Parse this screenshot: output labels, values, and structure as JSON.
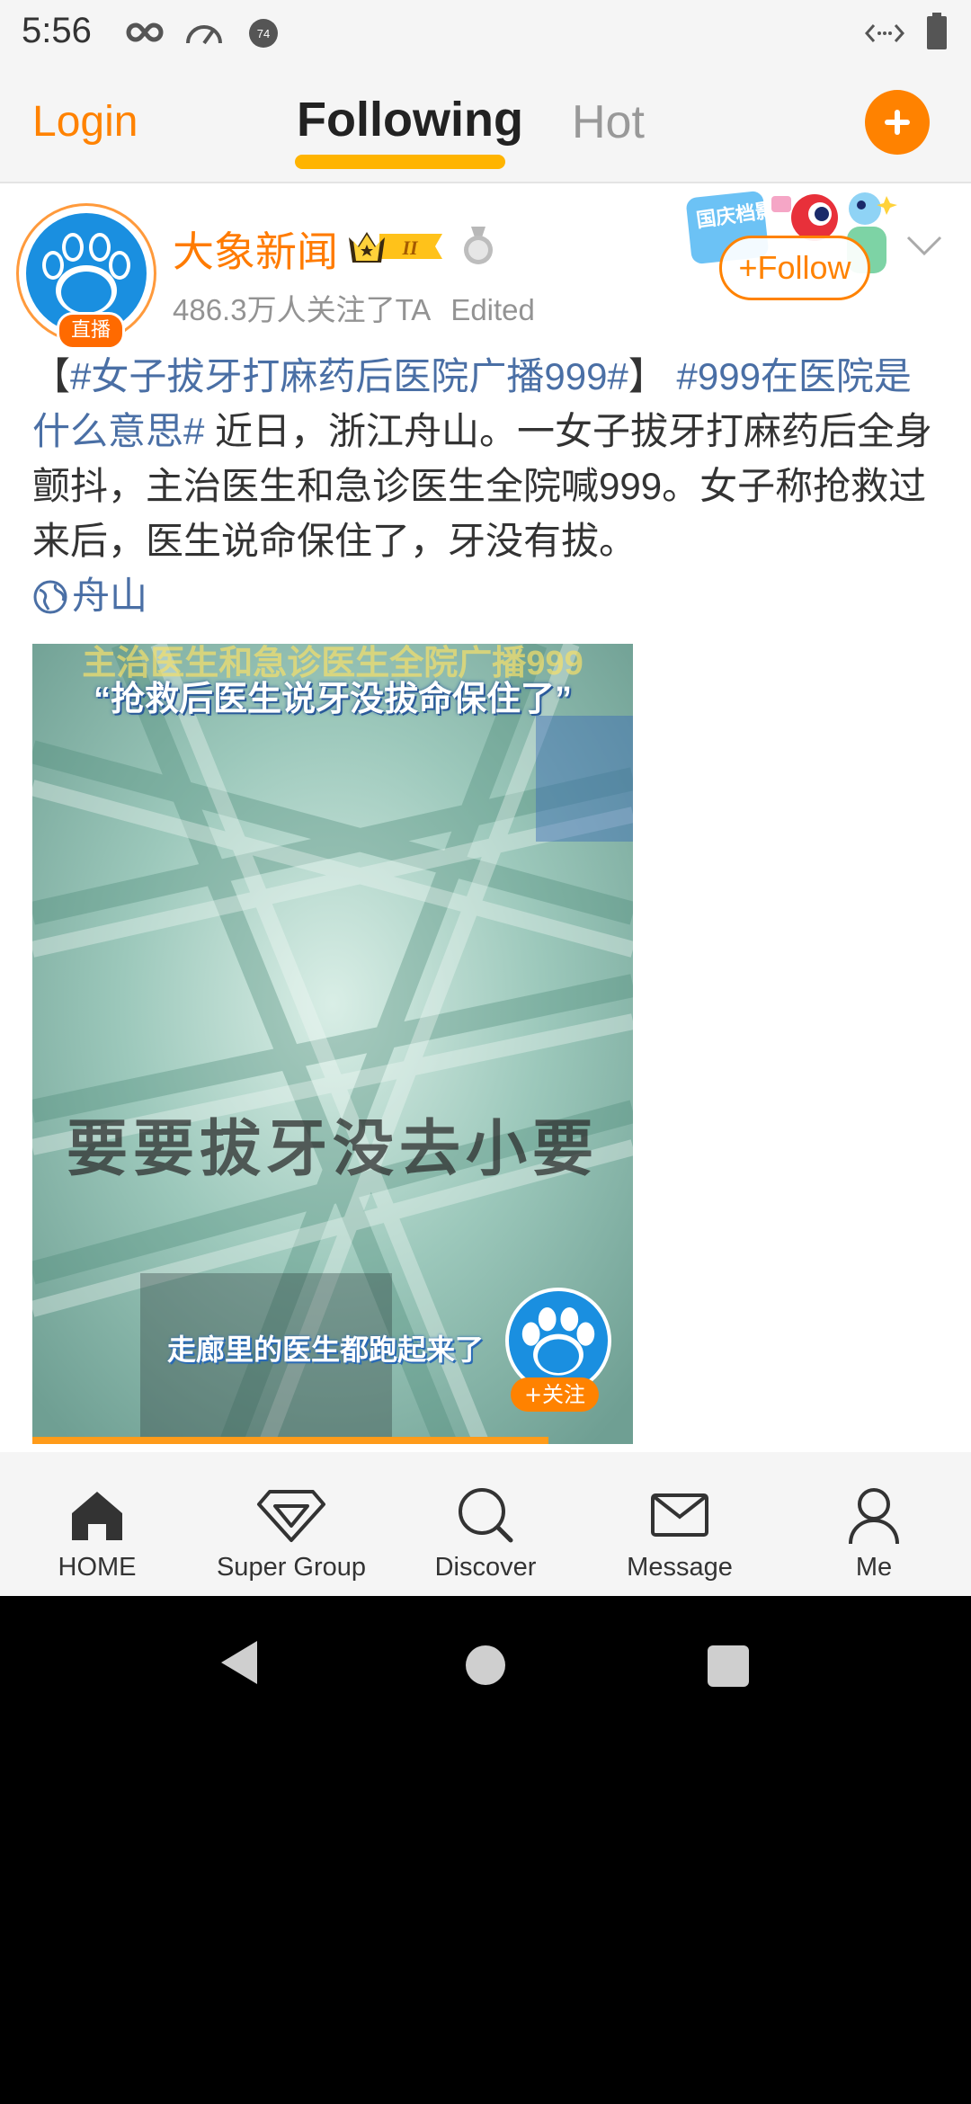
{
  "status_bar": {
    "time": "5:56",
    "icons": [
      "infinity-icon",
      "speedometer-icon",
      "notification-74-icon",
      "code-arrows-icon",
      "battery-icon"
    ],
    "notification_count": "74"
  },
  "header": {
    "login_label": "Login",
    "tabs": [
      {
        "label": "Following",
        "active": true
      },
      {
        "label": "Hot",
        "active": false
      }
    ],
    "accent_color": "#ff8200"
  },
  "post": {
    "author": {
      "name": "大象新闻",
      "live_badge": "直播",
      "vip_level": "II",
      "followers_text": "486.3万人关注了TA",
      "edited_label": "Edited"
    },
    "follow_label": "+Follow",
    "promo_text": "国庆档影评",
    "content": {
      "open_bracket": "【",
      "tag1": "#女子拔牙打麻药后医院广播999#",
      "close_bracket": "】",
      "tag2": "#999在医院是什么意思#",
      "body": " 近日，浙江舟山。一女子拔牙打麻药后全身颤抖，主治医生和急诊医生全院喊999。女子称抢救过来后，医生说命保住了，牙没有拔。",
      "location": "舟山"
    },
    "video": {
      "top_caption": "主治医生和急诊医生全院广播999",
      "quote_caption": "“抢救后医生说牙没拔命保住了”",
      "middle_caption": "要要拔牙没去小要",
      "bottom_caption": "走廊里的医生都跑起来了",
      "follow_badge": "+关注",
      "progress": 0.86
    }
  },
  "bottom_nav": [
    {
      "label": "HOME",
      "icon": "home-icon"
    },
    {
      "label": "Super Group",
      "icon": "diamond-icon"
    },
    {
      "label": "Discover",
      "icon": "search-icon"
    },
    {
      "label": "Message",
      "icon": "mail-icon"
    },
    {
      "label": "Me",
      "icon": "person-icon"
    }
  ]
}
